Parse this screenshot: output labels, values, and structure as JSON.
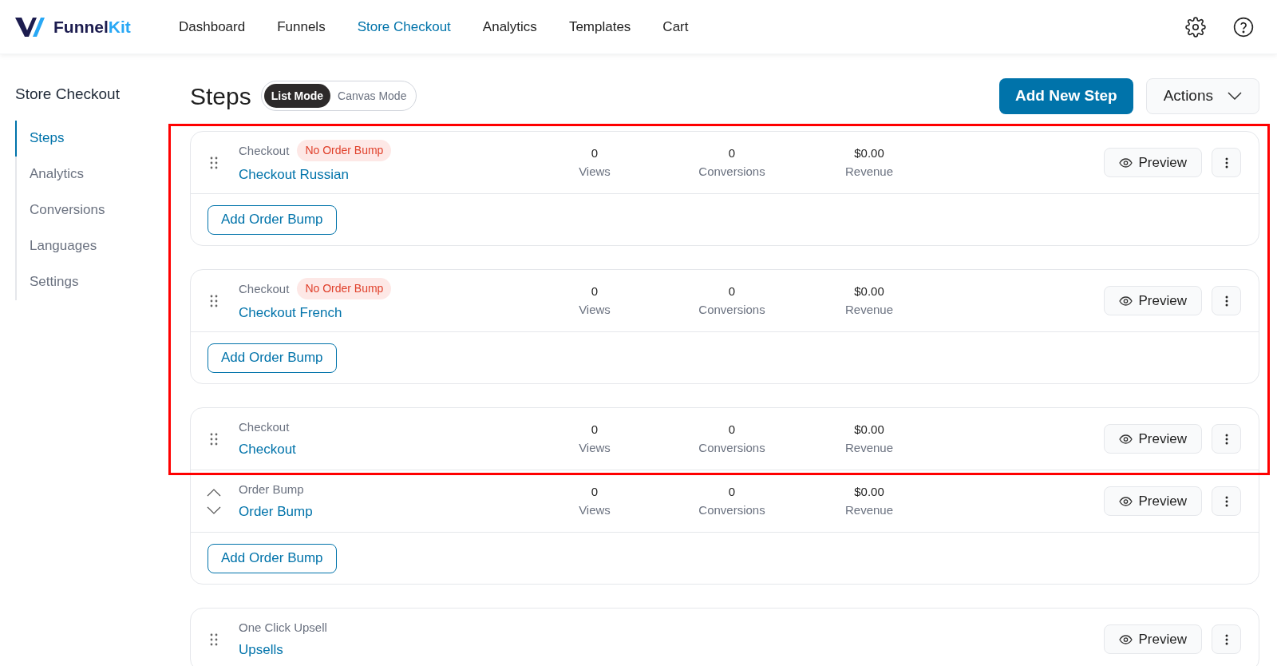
{
  "brand": {
    "name_dark": "Funnel",
    "name_light": "Kit"
  },
  "nav": [
    {
      "label": "Dashboard",
      "selected": false
    },
    {
      "label": "Funnels",
      "selected": false
    },
    {
      "label": "Store Checkout",
      "selected": true
    },
    {
      "label": "Analytics",
      "selected": false
    },
    {
      "label": "Templates",
      "selected": false
    },
    {
      "label": "Cart",
      "selected": false
    }
  ],
  "sidebar": {
    "title": "Store Checkout",
    "items": [
      {
        "label": "Steps",
        "selected": true
      },
      {
        "label": "Analytics",
        "selected": false
      },
      {
        "label": "Conversions",
        "selected": false
      },
      {
        "label": "Languages",
        "selected": false
      },
      {
        "label": "Settings",
        "selected": false
      }
    ]
  },
  "heading": "Steps",
  "modes": [
    {
      "label": "List Mode",
      "selected": true
    },
    {
      "label": "Canvas Mode",
      "selected": false
    }
  ],
  "add_step_button": "Add New Step",
  "actions_button": "Actions",
  "steps": [
    {
      "rows": [
        {
          "kind": "step",
          "type": "Checkout",
          "badge": "No Order Bump",
          "title": "Checkout Russian",
          "stats": [
            {
              "value": "0",
              "label": "Views"
            },
            {
              "value": "0",
              "label": "Conversions"
            },
            {
              "value": "$0.00",
              "label": "Revenue"
            }
          ],
          "preview": "Preview"
        }
      ],
      "add_bump": "Add Order Bump"
    },
    {
      "rows": [
        {
          "kind": "step",
          "type": "Checkout",
          "badge": "No Order Bump",
          "title": "Checkout French",
          "stats": [
            {
              "value": "0",
              "label": "Views"
            },
            {
              "value": "0",
              "label": "Conversions"
            },
            {
              "value": "$0.00",
              "label": "Revenue"
            }
          ],
          "preview": "Preview"
        }
      ],
      "add_bump": "Add Order Bump"
    },
    {
      "rows": [
        {
          "kind": "step",
          "type": "Checkout",
          "title": "Checkout",
          "stats": [
            {
              "value": "0",
              "label": "Views"
            },
            {
              "value": "0",
              "label": "Conversions"
            },
            {
              "value": "$0.00",
              "label": "Revenue"
            }
          ],
          "preview": "Preview"
        },
        {
          "kind": "bump",
          "type": "Order Bump",
          "title": "Order Bump",
          "stats": [
            {
              "value": "0",
              "label": "Views"
            },
            {
              "value": "0",
              "label": "Conversions"
            },
            {
              "value": "$0.00",
              "label": "Revenue"
            }
          ],
          "preview": "Preview"
        }
      ],
      "add_bump": "Add Order Bump"
    },
    {
      "rows": [
        {
          "kind": "step",
          "type": "One Click Upsell",
          "title": "Upsells",
          "preview": "Preview"
        }
      ]
    }
  ]
}
